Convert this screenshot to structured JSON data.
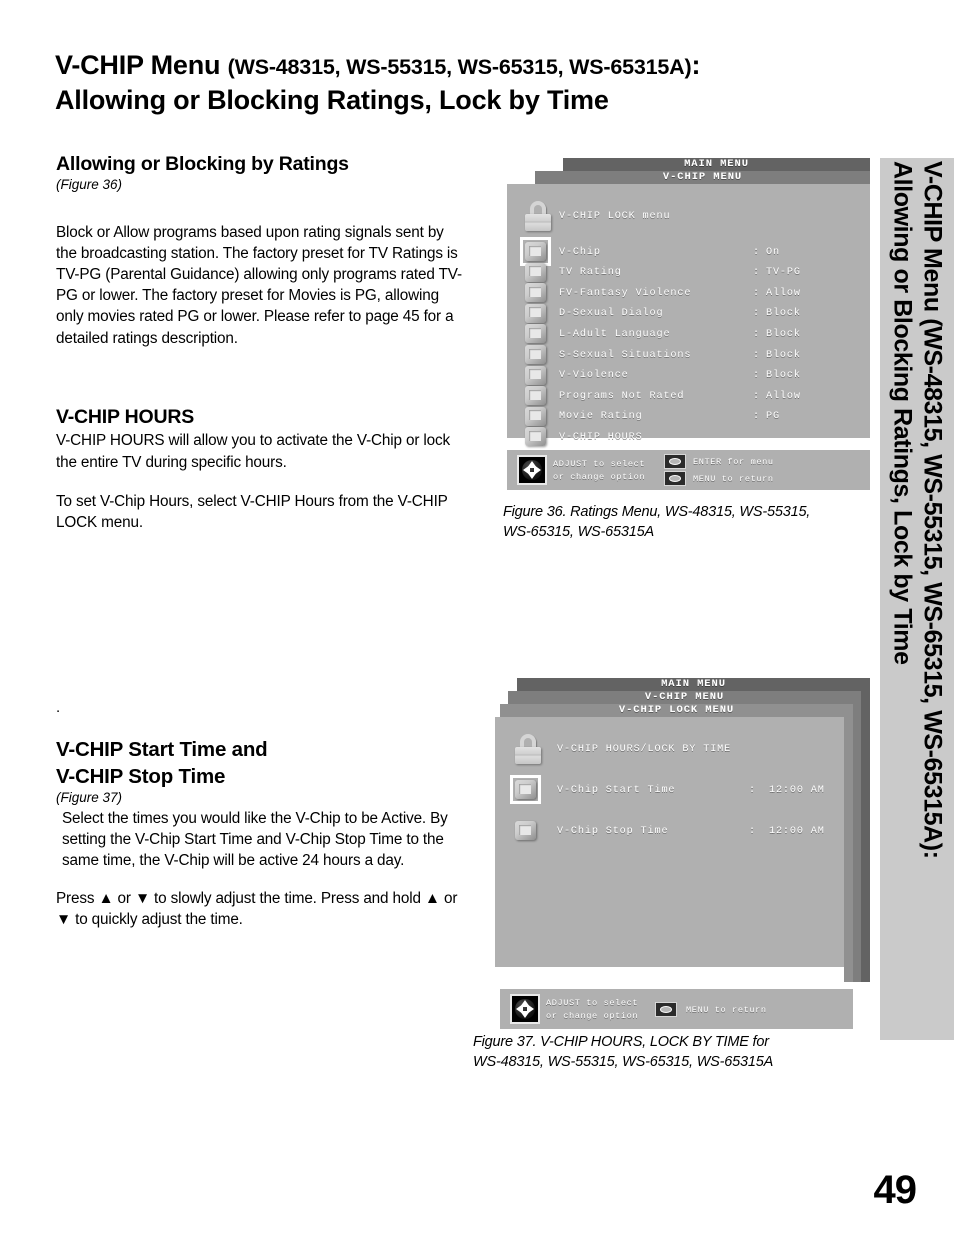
{
  "page": {
    "number": "49",
    "title_main": "V-CHIP Menu ",
    "title_models": "(WS-48315, WS-55315, WS-65315, WS-65315A)",
    "title_colon": ":",
    "title_line2": "Allowing or Blocking Ratings, Lock by Time",
    "side_tab_text": "V-CHIP Menu (WS-48315, WS-55315, WS-65315, WS-65315A):\nAllowing or Blocking Ratings, Lock by Time",
    "dot_marker": "."
  },
  "sections": {
    "ratings": {
      "heading": "Allowing or Blocking  by Ratings",
      "figref": "(Figure 36)",
      "body": "Block or Allow programs based upon rating signals sent by the broadcasting station.  The factory preset for TV Ratings is TV-PG (Parental Guidance) allowing only programs rated TV-PG or lower.  The factory preset for Movies is PG, allowing only movies rated PG or lower.  Please refer to page 45 for a detailed ratings description."
    },
    "hours": {
      "heading": "V-CHIP HOURS",
      "body1": "V-CHIP HOURS will allow you to activate the V-Chip or lock the entire TV during specific hours.",
      "body2": "To set V-Chip Hours, select V-CHIP Hours from the V-CHIP LOCK menu."
    },
    "times": {
      "heading_line1": "V-CHIP Start Time and",
      "heading_line2": "V-CHIP Stop Time",
      "figref": "(Figure 37)",
      "body1": "Select the times you would like the V-Chip to be Active.  By setting the V-Chip Start Time and V-Chip Stop Time to the same time, the V-Chip will be active 24 hours a day.",
      "body2": "Press ▲ or  ▼ to slowly adjust the time.  Press and hold ▲ or ▼ to quickly adjust the time."
    }
  },
  "figure36": {
    "caption": "Figure 36.  Ratings Menu, WS-48315, WS-55315,\nWS-65315, WS-65315A",
    "titlebars": [
      "MAIN MENU",
      "V-CHIP MENU"
    ],
    "header_row": {
      "label": "V-CHIP LOCK menu",
      "icon": "lock-icon"
    },
    "rows": [
      {
        "label": "V-Chip",
        "colon": ":",
        "value": "On",
        "selected": true
      },
      {
        "label": "TV Rating",
        "colon": ":",
        "value": "TV-PG",
        "selected": false
      },
      {
        "label": "FV-Fantasy Violence",
        "colon": ":",
        "value": "Allow",
        "selected": false
      },
      {
        "label": "D-Sexual Dialog",
        "colon": ":",
        "value": "Block",
        "selected": false
      },
      {
        "label": "L-Adult Language",
        "colon": ":",
        "value": "Block",
        "selected": false
      },
      {
        "label": "S-Sexual Situations",
        "colon": ":",
        "value": "Block",
        "selected": false
      },
      {
        "label": "V-Violence",
        "colon": ":",
        "value": "Block",
        "selected": false
      },
      {
        "label": "Programs Not Rated",
        "colon": ":",
        "value": "Allow",
        "selected": false
      },
      {
        "label": "Movie Rating",
        "colon": ":",
        "value": "PG",
        "selected": false
      },
      {
        "label": "V-CHIP HOURS",
        "colon": "",
        "value": "",
        "selected": false
      }
    ],
    "helpbar": {
      "adjust_text": "ADJUST to select\nor  change option",
      "enter_text": "ENTER for menu",
      "menu_text": "MENU to return"
    }
  },
  "figure37": {
    "caption": "Figure 37. V-CHIP HOURS, LOCK BY TIME  for\nWS-48315, WS-55315, WS-65315, WS-65315A",
    "titlebars": [
      "MAIN MENU",
      "V-CHIP MENU",
      "V-CHIP LOCK MENU"
    ],
    "header_row": {
      "label": "V-CHIP HOURS/LOCK BY TIME",
      "icon": "lock-icon"
    },
    "rows": [
      {
        "label": "V-Chip Start Time",
        "colon": ":",
        "value": "12:00 AM",
        "selected": true
      },
      {
        "label": "V-Chip Stop Time",
        "colon": ":",
        "value": "12:00 AM",
        "selected": false
      }
    ],
    "helpbar": {
      "adjust_text": "ADJUST to select\nor  change option",
      "menu_text": "MENU to return"
    }
  },
  "colors": {
    "osd_body": "#b0b0b0",
    "titlebar_dark": "#636363",
    "titlebar_mid": "#7e7e7e",
    "titlebar_light": "#909090",
    "side_tab": "#cacaca",
    "text_white": "#ffffff"
  }
}
